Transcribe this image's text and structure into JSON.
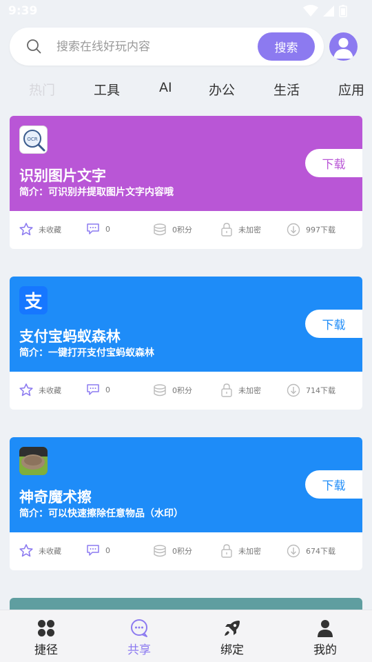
{
  "status_bar": {
    "time": "9:39"
  },
  "search": {
    "placeholder": "搜索在线好玩内容",
    "button_label": "搜索"
  },
  "tabs": [
    {
      "label": "热门",
      "active": true
    },
    {
      "label": "工具"
    },
    {
      "label": "AI"
    },
    {
      "label": "办公"
    },
    {
      "label": "生活"
    },
    {
      "label": "应用"
    }
  ],
  "cards": [
    {
      "title": "识别图片文字",
      "desc": "简介：可识别并提取图片文字内容哦",
      "download_label": "下载",
      "color": "#b956d6",
      "icon": "ocr-icon",
      "stats": {
        "fav": "未收藏",
        "comments": "0",
        "points": "0积分",
        "lock": "未加密",
        "downloads": "997下载"
      }
    },
    {
      "title": "支付宝蚂蚁森林",
      "desc": "简介：一键打开支付宝蚂蚁森林",
      "download_label": "下载",
      "color": "#1e8cf8",
      "icon": "alipay-icon",
      "icon_text": "支",
      "stats": {
        "fav": "未收藏",
        "comments": "0",
        "points": "0积分",
        "lock": "未加密",
        "downloads": "714下载"
      }
    },
    {
      "title": "神奇魔术擦",
      "desc": "简介：可以快速擦除任意物品（水印）",
      "download_label": "下载",
      "color": "#1e8cf8",
      "icon": "magic-eraser-icon",
      "stats": {
        "fav": "未收藏",
        "comments": "0",
        "points": "0积分",
        "lock": "未加密",
        "downloads": "674下载"
      }
    }
  ],
  "peek_card_color": "#5f9ea0",
  "bottom_nav": [
    {
      "label": "捷径",
      "icon": "shortcut-icon"
    },
    {
      "label": "共享",
      "icon": "share-chat-icon",
      "active": true
    },
    {
      "label": "绑定",
      "icon": "rocket-icon"
    },
    {
      "label": "我的",
      "icon": "person-icon"
    }
  ],
  "colors": {
    "accent": "#8c7af0",
    "background": "#eef1f5"
  }
}
